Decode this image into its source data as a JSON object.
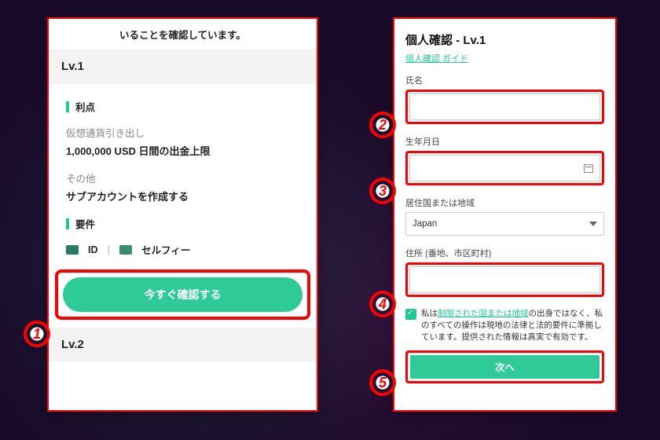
{
  "left": {
    "top_banner": "いることを確認しています。",
    "lv1_header": "Lv.1",
    "benefits_label": "利点",
    "crypto_withdraw_label": "仮想通貨引き出し",
    "crypto_withdraw_value": "1,000,000 USD 日間の出金上限",
    "other_label": "その他",
    "other_value": "サブアカウントを作成する",
    "requirements_label": "要件",
    "req_id": "ID",
    "req_selfie": "セルフィー",
    "confirm_button": "今すぐ確認する",
    "lv2_header": "Lv.2"
  },
  "right": {
    "title": "個人確認 - Lv.1",
    "guide_link": "個人確認 ガイド",
    "name_label": "氏名",
    "dob_label": "生年月日",
    "country_label": "居住国または地域",
    "country_value": "Japan",
    "address_label": "住所 (番地、市区町村)",
    "consent_pre": "私は",
    "consent_link": "制限された国または地域",
    "consent_post": "の出身ではなく、私のすべての操作は現地の法律と法的要件に準拠しています。提供された情報は真実で有効です。",
    "next_button": "次へ"
  },
  "markers": {
    "m1": "1",
    "m2": "2",
    "m3": "3",
    "m4": "4",
    "m5": "5"
  }
}
